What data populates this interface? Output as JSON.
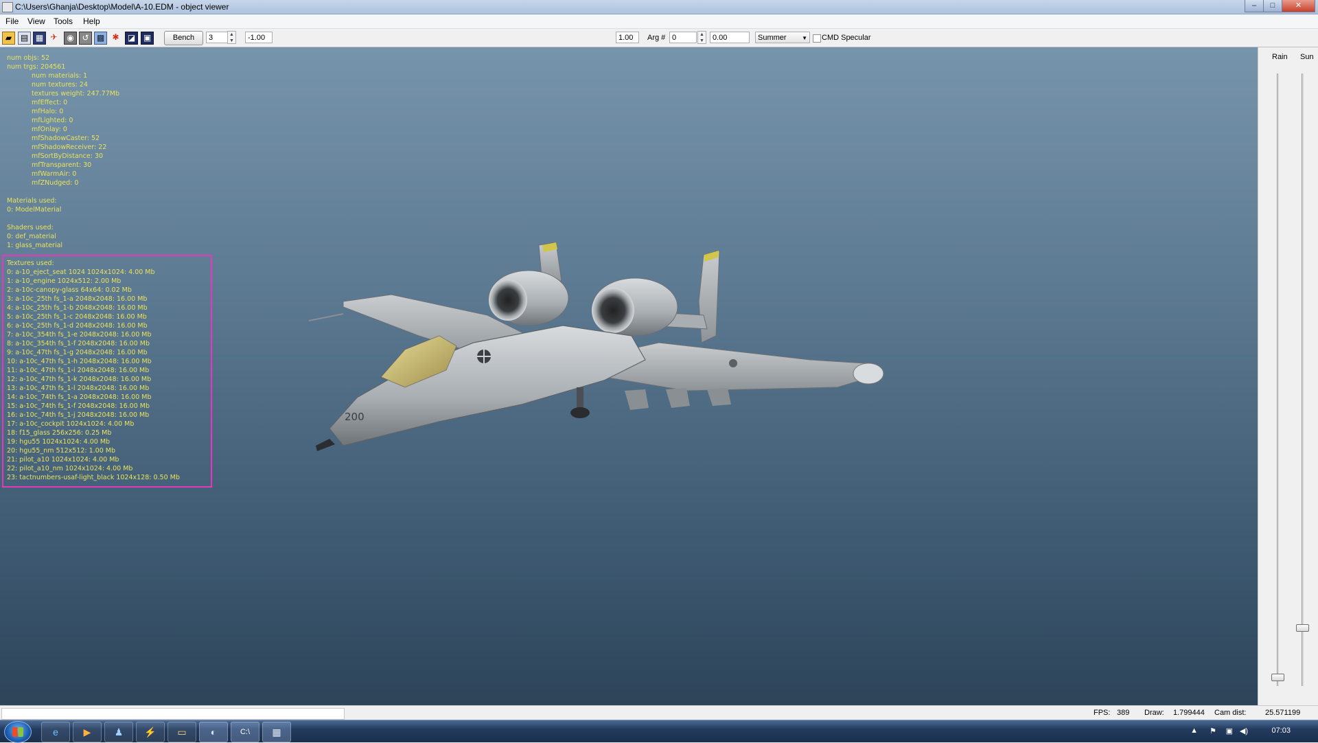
{
  "window": {
    "title": "C:\\Users\\Ghanja\\Desktop\\Model\\A-10.EDM - object viewer",
    "min_label": "–",
    "max_label": "□",
    "close_label": "✕"
  },
  "menu": [
    "File",
    "View",
    "Tools",
    "Help"
  ],
  "toolbar": {
    "icons": [
      "open-icon",
      "save-icon",
      "export-icon",
      "model-icon",
      "camera-icon",
      "camera-reset-icon",
      "grid-icon",
      "skeleton-icon",
      "render-icon",
      "info-icon"
    ],
    "bench_label": "Bench",
    "bench_value": "3",
    "arg_min": "-1.00",
    "slider_fraction": 0.47,
    "arg_max": "1.00",
    "arg_label": "Arg #",
    "arg_index": "0",
    "arg_value": "0.00",
    "season": "Summer",
    "cmd_specular_label": "CMD Specular",
    "cmd_specular_checked": false
  },
  "stats": {
    "header": [
      "num objs: 52",
      "num trgs: 204561"
    ],
    "details": [
      "num materials: 1",
      "num textures: 24",
      "textures weight: 247.77Mb",
      "mfEffect: 0",
      "mfHalo: 0",
      "mfLighted: 0",
      "mfOnlay: 0",
      "mfShadowCaster: 52",
      "mfShadowReceiver: 22",
      "mfSortByDistance: 30",
      "mfTransparent: 30",
      "mfWarmAir: 0",
      "mfZNudged: 0"
    ],
    "materials_title": "Materials used:",
    "materials": [
      "0: ModelMaterial"
    ],
    "shaders_title": "Shaders used:",
    "shaders": [
      "0: def_material",
      "1: glass_material"
    ],
    "textures_title": "Textures used:",
    "textures": [
      "0: a-10_eject_seat 1024 1024x1024: 4.00 Mb",
      "1: a-10_engine 1024x512: 2.00 Mb",
      "2: a-10c-canopy-glass 64x64: 0.02 Mb",
      "3: a-10c_25th fs_1-a 2048x2048: 16.00 Mb",
      "4: a-10c_25th fs_1-b 2048x2048: 16.00 Mb",
      "5: a-10c_25th fs_1-c 2048x2048: 16.00 Mb",
      "6: a-10c_25th fs_1-d 2048x2048: 16.00 Mb",
      "7: a-10c_354th fs_1-e 2048x2048: 16.00 Mb",
      "8: a-10c_354th fs_1-f 2048x2048: 16.00 Mb",
      "9: a-10c_47th fs_1-g 2048x2048: 16.00 Mb",
      "10: a-10c_47th fs_1-h 2048x2048: 16.00 Mb",
      "11: a-10c_47th fs_1-i 2048x2048: 16.00 Mb",
      "12: a-10c_47th fs_1-k 2048x2048: 16.00 Mb",
      "13: a-10c_47th fs_1-l 2048x2048: 16.00 Mb",
      "14: a-10c_74th fs_1-a 2048x2048: 16.00 Mb",
      "15: a-10c_74th fs_1-f 2048x2048: 16.00 Mb",
      "16: a-10c_74th fs_1-j 2048x2048: 16.00 Mb",
      "17: a-10c_cockpit 1024x1024: 4.00 Mb",
      "18: f15_glass 256x256: 0.25 Mb",
      "19: hgu55 1024x1024: 4.00 Mb",
      "20: hgu55_nm 512x512: 1.00 Mb",
      "21: pilot_a10 1024x1024: 4.00 Mb",
      "22: pilot_a10_nm 1024x1024: 4.00 Mb",
      "23: tactnumbers-usaf-light_black 1024x128: 0.50 Mb"
    ],
    "text_color": "#e9e35c",
    "highlight_color": "#e23ab8"
  },
  "aircraft": {
    "nose_number": "200"
  },
  "right_panel": {
    "rain_label": "Rain",
    "sun_label": "Sun",
    "rain_level": 0.0,
    "sun_level": 0.07
  },
  "status": {
    "fps_label": "FPS:",
    "fps": "389",
    "draw_label": "Draw:",
    "draw": "1.799444",
    "camdist_label": "Cam dist:",
    "camdist": "25.571199"
  },
  "taskbar": {
    "items": [
      "ie-icon",
      "media-player-icon",
      "users-icon",
      "winamp-icon",
      "explorer-icon",
      "object-viewer-icon",
      "terminal-icon",
      "calculator-icon"
    ],
    "clock": "07:03"
  }
}
